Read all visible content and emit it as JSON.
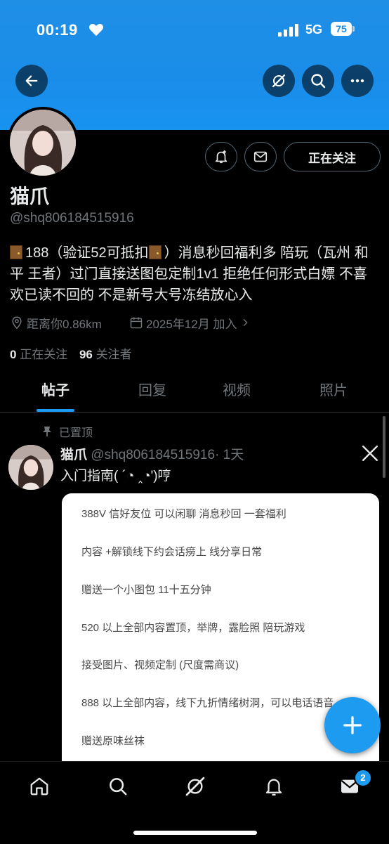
{
  "status_bar": {
    "time": "00:19",
    "network": "5G",
    "battery": "75"
  },
  "profile": {
    "name": "猫爪",
    "handle": "@shq806184515916",
    "bio_parts": [
      "188（验证52可抵扣",
      "）消息秒回福利多 陪玩（瓦州 和平 王者）过门直接送图包定制1v1 拒绝任何形式白嫖 不喜欢已读不回的 不是新号大号冻结放心入"
    ],
    "location": "距离你0.86km",
    "joined": "2025年12月 加入",
    "following_count": "0",
    "following_label": "正在关注",
    "followers_count": "96",
    "followers_label": "关注者"
  },
  "actions": {
    "following_button": "正在关注"
  },
  "tabs": [
    "帖子",
    "回复",
    "视频",
    "照片"
  ],
  "pinned_label": "已置顶",
  "post": {
    "name": "猫爪",
    "handle": "@shq806184515916",
    "time": "· 1天",
    "text": "入门指南( ´◔ ‸◔')哼",
    "card_lines": [
      "388V 信好友位 可以闲聊 消息秒回 一套福利",
      "内容 +解锁线下约会话痨上 线分享日常",
      "赠送一个小图包 11十五分钟",
      "520 以上全部内容置顶，举牌，露脸照 陪玩游戏",
      "接受图片、视频定制 (尺度需商议)",
      "888 以上全部内容，线下九折情绪树洞，可以电话语音",
      "赠送原味丝袜"
    ]
  },
  "nav": {
    "messages_badge": "2"
  },
  "colors": {
    "accent": "#1d9bf0",
    "banner": "#1a8de9",
    "muted": "#71767b"
  }
}
